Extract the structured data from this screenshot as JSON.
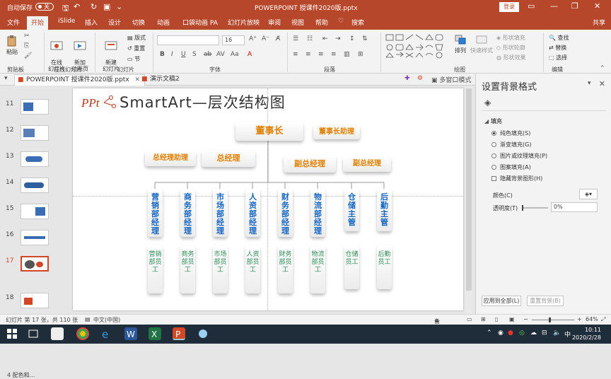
{
  "titlebar": {
    "autosave_label": "自动保存",
    "autosave_state": "关",
    "document_title": "POWERPOINT 授课件2020版.pptx",
    "login_label": "登录"
  },
  "tabs": [
    {
      "label": "文件"
    },
    {
      "label": "开始"
    },
    {
      "label": "iSlide"
    },
    {
      "label": "插入"
    },
    {
      "label": "设计"
    },
    {
      "label": "切换"
    },
    {
      "label": "动画"
    },
    {
      "label": "口袋动画 PA"
    },
    {
      "label": "幻灯片放映"
    },
    {
      "label": "审阅"
    },
    {
      "label": "视图"
    },
    {
      "label": "帮助"
    },
    {
      "label": "♡"
    },
    {
      "label": "搜索"
    }
  ],
  "share_label": "共享",
  "ribbon": {
    "paste": "粘贴",
    "clipboard_group": "剪贴板",
    "online_slides": "在线\n幻灯片",
    "new_animation": "新加\n动画页",
    "online_group": "在线幻灯片",
    "new_slide": "新建\n幻灯片",
    "layout": "版式",
    "reset": "重置",
    "section": "节",
    "slides_group": "幻灯片",
    "font_size": "16",
    "font_group": "字体",
    "paragraph_group": "段落",
    "arrange": "排列",
    "quick_styles": "快速样式",
    "shape_fill": "形状填充",
    "shape_outline": "形状轮廓",
    "shape_effects": "形状效果",
    "drawing_group": "绘图",
    "find": "查找",
    "replace": "替换",
    "select": "选择",
    "editing_group": "编辑"
  },
  "doc_tabs": [
    {
      "label": "POWERPOINT 授课件2020版.pptx"
    },
    {
      "label": "演示文稿2"
    }
  ],
  "multi_window_label": "多窗口模式",
  "thumbnails": [
    {
      "num": "11"
    },
    {
      "num": "12"
    },
    {
      "num": "13"
    },
    {
      "num": "14"
    },
    {
      "num": "15"
    },
    {
      "num": "16"
    },
    {
      "num": "17"
    },
    {
      "num": "18"
    }
  ],
  "section_label": "4 配色和...",
  "slide": {
    "logo_text": "PPt",
    "title": "SmartArt—层次结构图",
    "chairman": "董事长",
    "chairman_assistant": "董事长助理",
    "gm_assistant": "总经理助理",
    "gm": "总经理",
    "deputy_gm_1": "副总经理",
    "deputy_gm_2": "副总经理",
    "managers": [
      "营销部经理",
      "商务部经理",
      "市场部经理",
      "人资部经理",
      "财务部经理",
      "物流部经理",
      "仓储主管",
      "后勤主管"
    ],
    "staff": [
      "营销部员工",
      "商务部员工",
      "市场部员工",
      "人资部员工",
      "财务部员工",
      "物流部员工",
      "仓储员工",
      "后勤员工"
    ]
  },
  "format_panel": {
    "title": "设置背景格式",
    "fill_section": "填充",
    "options": [
      {
        "label": "纯色填充(S)",
        "type": "radio",
        "checked": true
      },
      {
        "label": "渐变填充(G)",
        "type": "radio",
        "checked": false
      },
      {
        "label": "图片或纹理填充(P)",
        "type": "radio",
        "checked": false
      },
      {
        "label": "图案填充(A)",
        "type": "radio",
        "checked": false
      },
      {
        "label": "隐藏背景图形(H)",
        "type": "checkbox",
        "checked": false
      }
    ],
    "color_label": "颜色(C)",
    "transparency_label": "透明度(T)",
    "transparency_value": "0%",
    "apply_all": "应用到全部(L)",
    "reset_bg": "重置背景(B)"
  },
  "statusbar": {
    "slide_info": "幻灯片 第 17 张，共 110 张",
    "language": "中文(中国)",
    "notes": "备注",
    "zoom": "64%"
  },
  "taskbar": {
    "time": "10:11",
    "date": "2020/2/28",
    "ime": "中"
  },
  "colors": {
    "accent": "#b7472a",
    "manager_text": "#1565c0",
    "staff_text": "#2e8b57",
    "exec_text": "#e08000"
  }
}
